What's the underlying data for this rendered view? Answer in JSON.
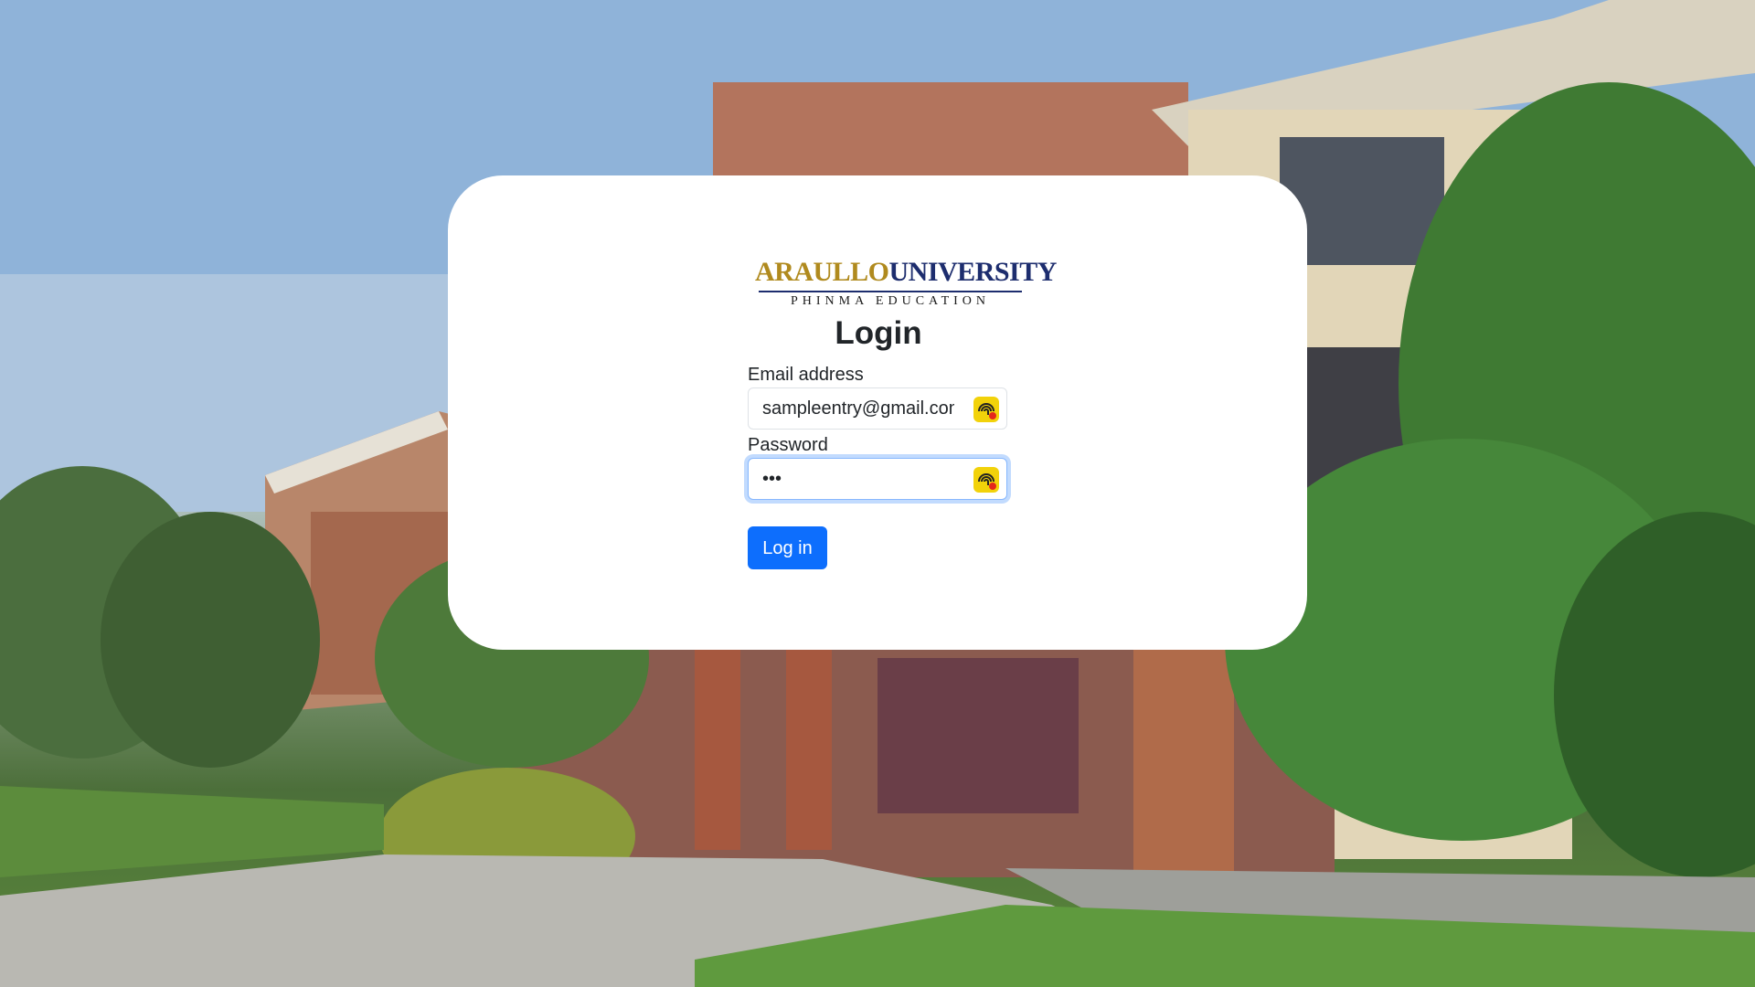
{
  "logo": {
    "word_araullo": "ARAULLO",
    "word_university": "UNIVERSITY",
    "subtitle": "PHINMA EDUCATION"
  },
  "login": {
    "title": "Login",
    "email_label": "Email address",
    "email_value": "sampleentry@gmail.com",
    "password_label": "Password",
    "password_value": "•••",
    "submit_label": "Log in"
  },
  "icons": {
    "field_extension": "password-manager-extension-icon"
  },
  "colors": {
    "primary": "#0d6efd",
    "focus_ring": "#86b7fe",
    "logo_gold": "#b08a1e",
    "logo_navy": "#1d2d6e",
    "extension_yellow": "#f2d20a"
  }
}
